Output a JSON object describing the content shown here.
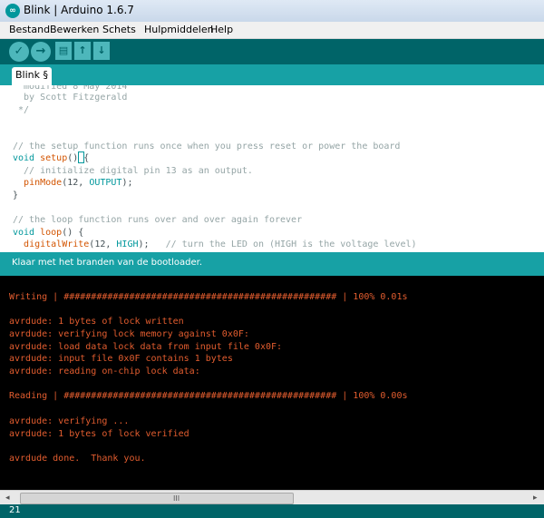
{
  "window": {
    "title": "Blink | Arduino 1.6.7",
    "icon": "arduino-logo-icon"
  },
  "menu": {
    "items": [
      "Bestand",
      "Bewerken",
      "Schets",
      "Hulpmiddelen",
      "Help"
    ]
  },
  "toolbar": {
    "buttons": [
      "verify-icon",
      "upload-icon",
      "new-icon",
      "open-icon",
      "save-icon"
    ]
  },
  "tab": {
    "label": "Blink §"
  },
  "editor": {
    "l1": "  modified 8 May 2014",
    "l2": "  by Scott Fitzgerald",
    "l3": " */",
    "setup_comment": "// the setup function runs once when you press reset or power the board",
    "setup_kw": "void",
    "setup_fn": "setup",
    "setup_rest": "() {",
    "init_comment": "  // initialize digital pin 13 as an output.",
    "pinmode_fn": "pinMode",
    "pinmode_args": "(12, ",
    "pinmode_const": "OUTPUT",
    "pinmode_end": ");",
    "close1": "}",
    "loop_comment": "// the loop function runs over and over again forever",
    "loop_kw": "void",
    "loop_fn": "loop",
    "loop_rest": "() {",
    "dw_fn": "digitalWrite",
    "dw_args": "(12, ",
    "dw_const": "HIGH",
    "dw_end": ");   ",
    "dw_comment": "// turn the LED on (HIGH is the voltage level)"
  },
  "status": {
    "message": "Klaar met het branden van de bootloader."
  },
  "console": {
    "lines": [
      "Writing | ################################################## | 100% 0.01s",
      "",
      "avrdude: 1 bytes of lock written",
      "avrdude: verifying lock memory against 0x0F:",
      "avrdude: load data lock data from input file 0x0F:",
      "avrdude: input file 0x0F contains 1 bytes",
      "avrdude: reading on-chip lock data:",
      "",
      "Reading | ################################################## | 100% 0.00s",
      "",
      "avrdude: verifying ...",
      "avrdude: 1 bytes of lock verified",
      "",
      "avrdude done.  Thank you."
    ]
  },
  "scrollbar": {
    "left_arrow": "◂",
    "right_arrow": "▸",
    "grip": "III"
  },
  "footer": {
    "line_number": "21"
  },
  "colors": {
    "teal_dark": "#006468",
    "teal": "#17a1a5",
    "console_text": "#e35d2f"
  }
}
